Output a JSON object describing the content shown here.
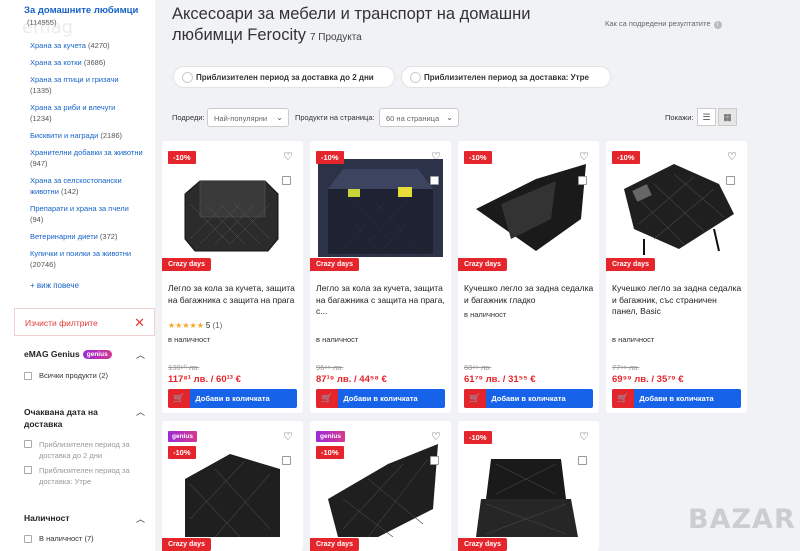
{
  "sidebar": {
    "main_category": "За домашните любимци",
    "main_count": "(114955)",
    "subcategories": [
      {
        "label": "Храна за кучета",
        "count": "(4270)"
      },
      {
        "label": "Храна за котки",
        "count": "(3686)"
      },
      {
        "label": "Храна за птици и гризачи",
        "count": "(1335)"
      },
      {
        "label": "Храна за риби и влечуги",
        "count": "(1234)"
      },
      {
        "label": "Бисквити и награди",
        "count": "(2186)"
      },
      {
        "label": "Хранителни добавки за животни",
        "count": "(947)"
      },
      {
        "label": "Храна за селскостопански животни",
        "count": "(142)"
      },
      {
        "label": "Препарати и храна за пчели",
        "count": "(94)"
      },
      {
        "label": "Ветеринарни диети",
        "count": "(372)"
      },
      {
        "label": "Купички и поилки за животни",
        "count": "(20746)"
      }
    ],
    "see_more": "+ виж повече",
    "clear_filters": "Изчисти филтрите",
    "genius_title": "eMAG Genius",
    "genius_pill": "genius",
    "genius_option": "Всички продукти (2)",
    "delivery_title": "Очаквана дата на доставка",
    "delivery_options": [
      "Приблизителен период за доставка до 2 дни",
      "Приблизителен период за доставка: Утре"
    ],
    "stock_title": "Наличност",
    "stock_option": "В наличност (7)"
  },
  "header": {
    "title": "Аксесоари за мебели и транспорт на домашни любимци Ferocity",
    "count": "7 Продукта",
    "rank_info": "Как са подредени резултатите"
  },
  "chips": [
    "Приблизителен период за доставка до 2 дни",
    "Приблизителен период за доставка: Утре"
  ],
  "toolbar": {
    "sort_label": "Подреди:",
    "sort_value": "Най-популярни",
    "per_page_label": "Продукти на страница:",
    "per_page_value": "60 на страница",
    "view_label": "Покажи:"
  },
  "products": [
    {
      "badge": "-10%",
      "name": "Легло за кола за кучета, защита на багажника с защита на прага",
      "stars": "★★★★★",
      "rating": "5",
      "reviews": "(1)",
      "stock": "в наличност",
      "old_price": "130⁹⁰ лв.",
      "new_price": "117⁸¹ лв. / 60¹³ €",
      "crazy": "Crazy days",
      "button": "Добави в количката"
    },
    {
      "badge": "-10%",
      "name": "Легло за кола за кучета, защита на багажника с защита на прага, с...",
      "stock": "в наличност",
      "old_price": "96⁹⁹ лв.",
      "new_price": "87¹⁹ лв. / 44⁵⁸ €",
      "crazy": "Crazy days",
      "button": "Добави в количката"
    },
    {
      "badge": "-10%",
      "name": "Кучешко легло за задна седалка и багажник гладко",
      "stock": "в наличност",
      "old_price": "68⁹⁹ лв.",
      "new_price": "61⁷⁹ лв. / 31⁵⁵ €",
      "crazy": "Crazy days",
      "button": "Добави в количката"
    },
    {
      "badge": "-10%",
      "name": "Кучешко легло за задна седалка и багажник, със страничен панел, Basic",
      "stock": "в наличност",
      "old_price": "77⁹⁹ лв.",
      "new_price": "69⁹⁹ лв. / 35⁷⁹ €",
      "crazy": "Crazy days",
      "button": "Добави в количката"
    },
    {
      "genius": "genius",
      "badge": "-10%",
      "crazy": "Crazy days"
    },
    {
      "genius": "genius",
      "badge": "-10%",
      "crazy": "Crazy days"
    },
    {
      "badge": "-10%",
      "crazy": "Crazy days"
    }
  ],
  "watermark": "BAZAR"
}
